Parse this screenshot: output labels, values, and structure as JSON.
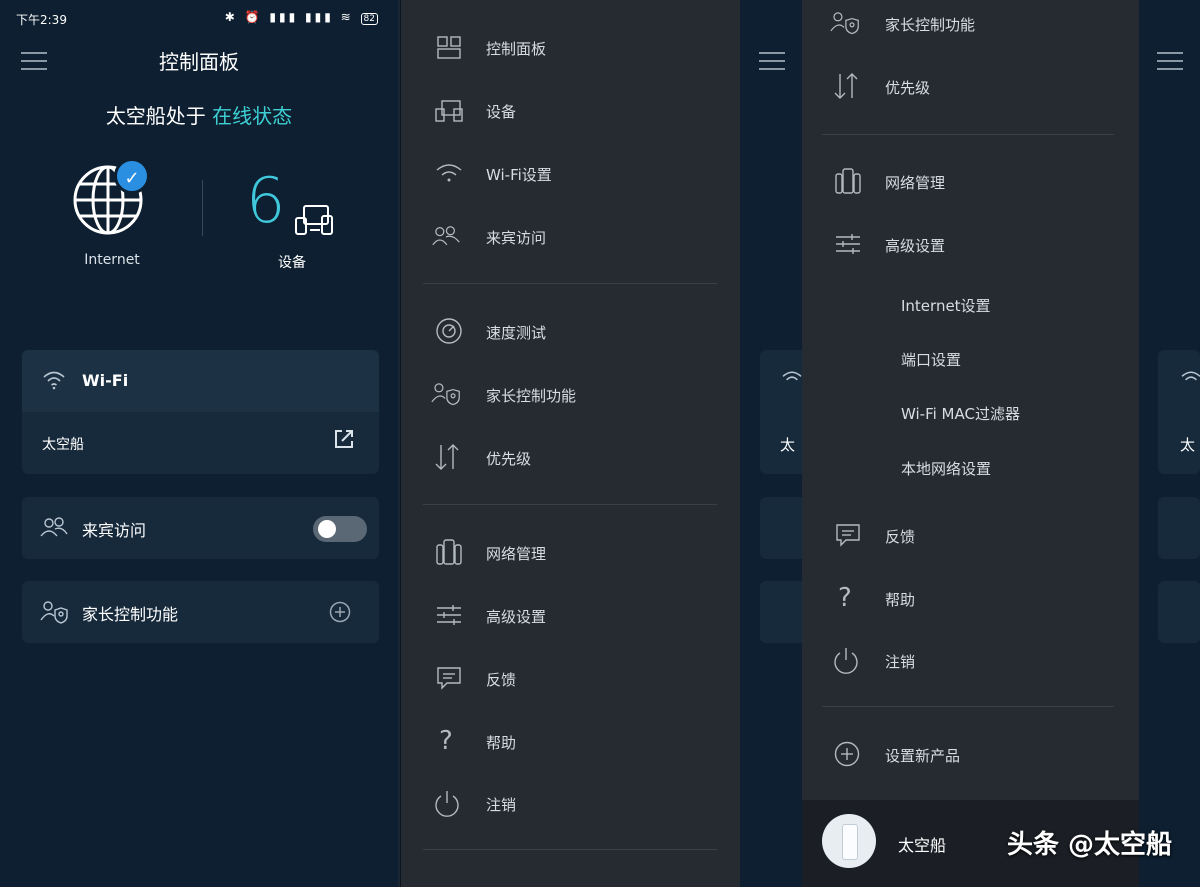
{
  "dashboard": {
    "status_bar": {
      "time": "下午2:39",
      "icons": "✱ ⏰ ▮▮▮ ▮▮▮ ≋",
      "battery": "82"
    },
    "title": "控制面板",
    "status_prefix": "太空船处于",
    "status_highlight": "在线状态",
    "internet_label": "Internet",
    "device_count": "6",
    "devices_label": "设备",
    "wifi_card": {
      "title": "Wi-Fi",
      "network_name": "太空船"
    },
    "guest_card": {
      "title": "来宾访问",
      "toggle": "off"
    },
    "parental_card": {
      "title": "家长控制功能"
    }
  },
  "drawer_left": {
    "group1": [
      "控制面板",
      "设备",
      "Wi-Fi设置",
      "来宾访问"
    ],
    "group2": [
      "速度测试",
      "家长控制功能",
      "优先级"
    ],
    "group3": [
      "网络管理",
      "高级设置",
      "反馈",
      "帮助",
      "注销"
    ]
  },
  "drawer_right": {
    "top": [
      "家长控制功能",
      "优先级"
    ],
    "network_mgmt": "网络管理",
    "advanced": "高级设置",
    "advanced_sub": [
      "Internet设置",
      "端口设置",
      "Wi-Fi MAC过滤器",
      "本地网络设置"
    ],
    "more": [
      "反馈",
      "帮助",
      "注销"
    ],
    "setup_new": "设置新产品",
    "node_name": "太空船"
  },
  "edge": {
    "text": "太"
  },
  "watermark": "头条 @太空船",
  "colors": {
    "accent": "#3ed0d4",
    "background": "#0d1f30",
    "drawer": "#262a31",
    "card": "#172a3c"
  }
}
